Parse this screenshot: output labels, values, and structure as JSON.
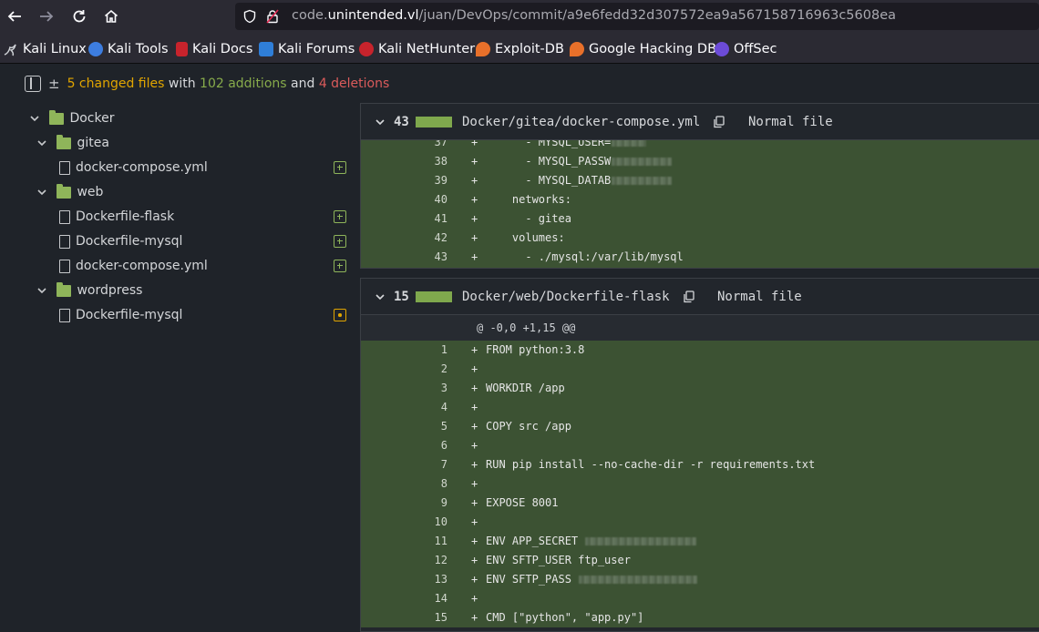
{
  "browser": {
    "url_prefix": "code.",
    "url_domain": "unintended.vl",
    "url_path": "/juan/DevOps/commit/a9e6fedd32d307572ea9a567158716963c5608ea"
  },
  "bookmarks": [
    {
      "label": "Kali Linux",
      "icon": "kali-dragon-icon",
      "color": "#cfd2d6"
    },
    {
      "label": "Kali Tools",
      "icon": "kali-tools-icon",
      "color": "#3d7de0"
    },
    {
      "label": "Kali Docs",
      "icon": "kali-docs-icon",
      "color": "#c8232c"
    },
    {
      "label": "Kali Forums",
      "icon": "kali-forums-icon",
      "color": "#2f7ed8"
    },
    {
      "label": "Kali NetHunter",
      "icon": "nethunter-icon",
      "color": "#c8232c"
    },
    {
      "label": "Exploit-DB",
      "icon": "exploitdb-icon",
      "color": "#e8702a"
    },
    {
      "label": "Google Hacking DB",
      "icon": "ghdb-icon",
      "color": "#e8702a"
    },
    {
      "label": "OffSec",
      "icon": "offsec-icon",
      "color": "#6c4bd8"
    }
  ],
  "summary": {
    "files": "5 changed files",
    "with": "with",
    "additions": "102 additions",
    "and": "and",
    "deletions": "4 deletions"
  },
  "tree": {
    "docker": "Docker",
    "gitea": "gitea",
    "gitea_compose": "docker-compose.yml",
    "web": "web",
    "web_flask": "Dockerfile-flask",
    "web_mysql": "Dockerfile-mysql",
    "web_compose": "docker-compose.yml",
    "wordpress": "wordpress",
    "wp_mysql": "Dockerfile-mysql"
  },
  "diff1": {
    "count": "43",
    "filename": "Docker/gitea/docker-compose.yml",
    "mode": "Normal file",
    "lines": [
      {
        "n": "37",
        "sign": "+",
        "text": "      - MYSQL_USER="
      },
      {
        "n": "38",
        "sign": "+",
        "text": "      - MYSQL_PASSW"
      },
      {
        "n": "39",
        "sign": "+",
        "text": "      - MYSQL_DATAB"
      },
      {
        "n": "40",
        "sign": "+",
        "text": "    networks:"
      },
      {
        "n": "41",
        "sign": "+",
        "text": "      - gitea"
      },
      {
        "n": "42",
        "sign": "+",
        "text": "    volumes:"
      },
      {
        "n": "43",
        "sign": "+",
        "text": "      - ./mysql:/var/lib/mysql"
      }
    ]
  },
  "diff2": {
    "count": "15",
    "filename": "Docker/web/Dockerfile-flask",
    "mode": "Normal file",
    "hunk": "@ -0,0 +1,15 @@",
    "lines": [
      {
        "n": "1",
        "sign": "+",
        "text": "FROM python:3.8"
      },
      {
        "n": "2",
        "sign": "+",
        "text": ""
      },
      {
        "n": "3",
        "sign": "+",
        "text": "WORKDIR /app"
      },
      {
        "n": "4",
        "sign": "+",
        "text": ""
      },
      {
        "n": "5",
        "sign": "+",
        "text": "COPY src /app"
      },
      {
        "n": "6",
        "sign": "+",
        "text": ""
      },
      {
        "n": "7",
        "sign": "+",
        "text": "RUN pip install --no-cache-dir -r requirements.txt"
      },
      {
        "n": "8",
        "sign": "+",
        "text": ""
      },
      {
        "n": "9",
        "sign": "+",
        "text": "EXPOSE 8001"
      },
      {
        "n": "10",
        "sign": "+",
        "text": ""
      },
      {
        "n": "11",
        "sign": "+",
        "text": "ENV APP_SECRET "
      },
      {
        "n": "12",
        "sign": "+",
        "text": "ENV SFTP_USER ftp_user"
      },
      {
        "n": "13",
        "sign": "+",
        "text": "ENV SFTP_PASS "
      },
      {
        "n": "14",
        "sign": "+",
        "text": ""
      },
      {
        "n": "15",
        "sign": "+",
        "text": "CMD [\"python\", \"app.py\"]"
      }
    ]
  }
}
